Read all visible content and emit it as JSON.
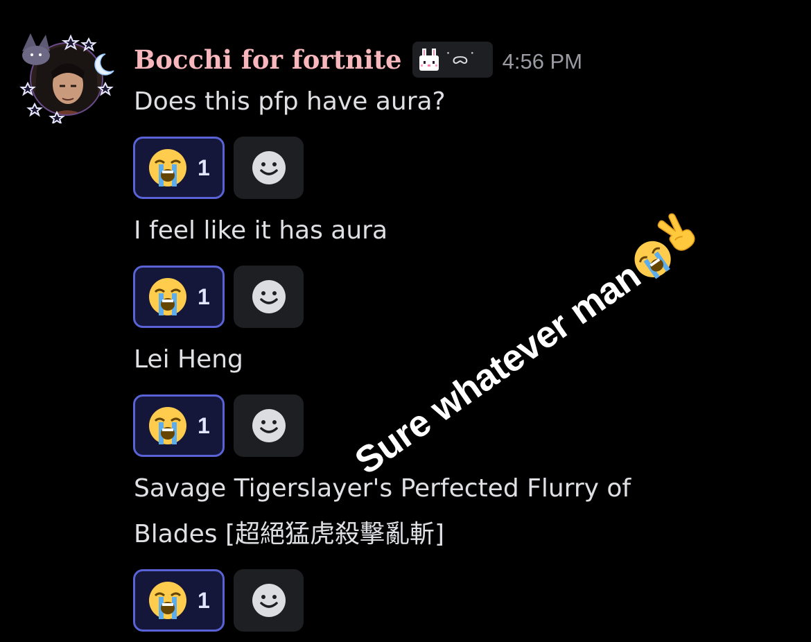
{
  "message": {
    "author": "Bocchi for fortnite",
    "timestamp": "4:56 PM",
    "tag_icon": "bunny-emoji",
    "avatar_icon": "decorated-avatar"
  },
  "lines": [
    {
      "text": "Does this pfp have aura?",
      "reaction_emoji": "loudly-crying-face",
      "reaction_count": "1"
    },
    {
      "text": "I feel like it has aura",
      "reaction_emoji": "loudly-crying-face",
      "reaction_count": "1"
    },
    {
      "text": "Lei Heng",
      "reaction_emoji": "loudly-crying-face",
      "reaction_count": "1"
    },
    {
      "text_line1": "Savage Tigerslayer's Perfected Flurry of",
      "text_line2": "Blades [超絕猛虎殺擊亂斬]",
      "reaction_emoji": "loudly-crying-face",
      "reaction_count": "1"
    }
  ],
  "add_reaction_icon": "smiley-add-reaction-icon",
  "overlay": {
    "text": "Sure whatever man",
    "emojis": [
      "loudly-crying-face",
      "victory-hand"
    ]
  },
  "colors": {
    "background": "#000000",
    "username": "#f7b7bd",
    "reaction_border": "#5a63d6",
    "reaction_bg": "#15173a",
    "add_reaction_bg": "#1e1f22"
  }
}
